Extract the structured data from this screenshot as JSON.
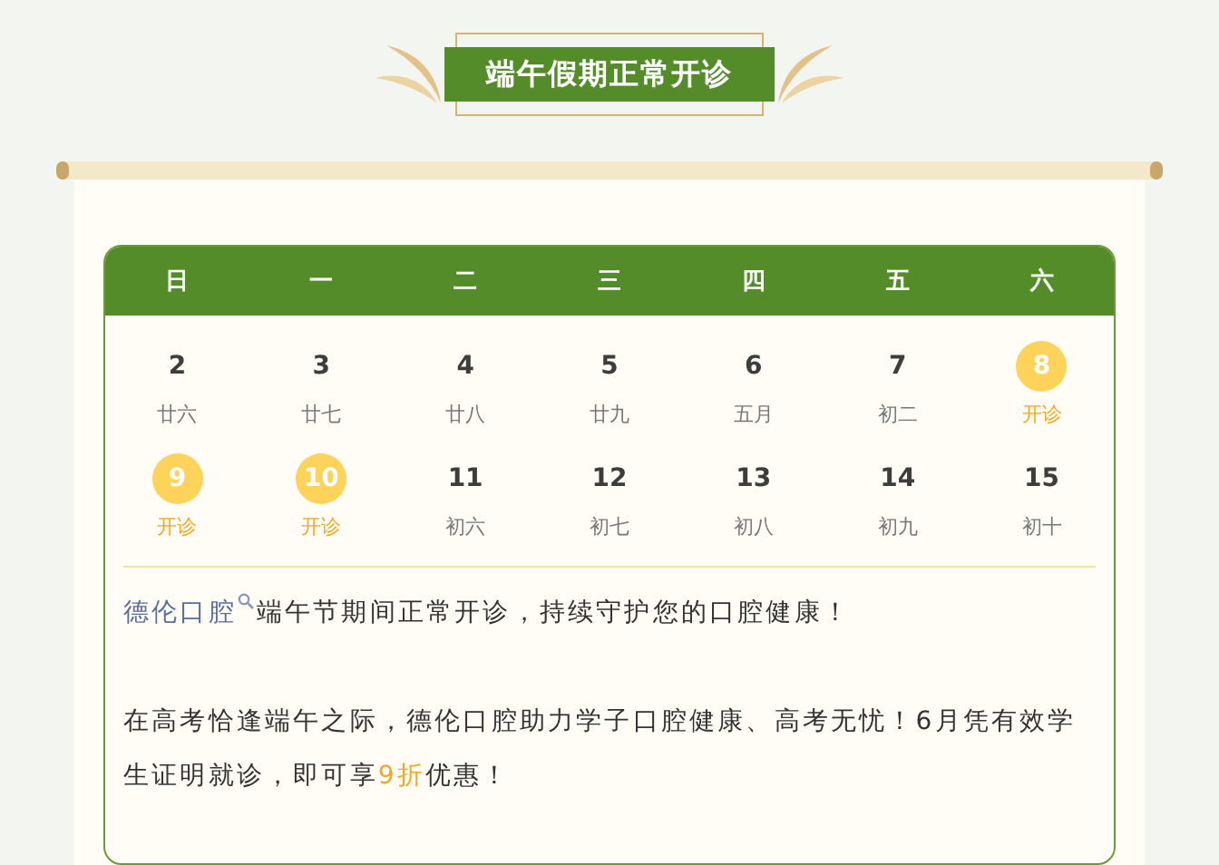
{
  "banner": {
    "title": "端午假期正常开诊"
  },
  "calendar": {
    "weekdays": [
      "日",
      "一",
      "二",
      "三",
      "四",
      "五",
      "六"
    ],
    "weeks": [
      [
        {
          "date": "2",
          "lunar": "廿六",
          "open": false
        },
        {
          "date": "3",
          "lunar": "廿七",
          "open": false
        },
        {
          "date": "4",
          "lunar": "廿八",
          "open": false
        },
        {
          "date": "5",
          "lunar": "廿九",
          "open": false
        },
        {
          "date": "6",
          "lunar": "五月",
          "open": false
        },
        {
          "date": "7",
          "lunar": "初二",
          "open": false
        },
        {
          "date": "8",
          "lunar": "开诊",
          "open": true
        }
      ],
      [
        {
          "date": "9",
          "lunar": "开诊",
          "open": true
        },
        {
          "date": "10",
          "lunar": "开诊",
          "open": true
        },
        {
          "date": "11",
          "lunar": "初六",
          "open": false
        },
        {
          "date": "12",
          "lunar": "初七",
          "open": false
        },
        {
          "date": "13",
          "lunar": "初八",
          "open": false
        },
        {
          "date": "14",
          "lunar": "初九",
          "open": false
        },
        {
          "date": "15",
          "lunar": "初十",
          "open": false
        }
      ]
    ]
  },
  "notice": {
    "link": "德伦口腔",
    "first_line": "端午节期间正常开诊，持续守护您的口腔健康！",
    "second": {
      "before": "在高考恰逢端午之际，德伦口腔助力学子口腔健康、高考无忧！6月凭有效学生证明就诊，即可享",
      "highlight": "9折",
      "after": "优惠！"
    }
  }
}
